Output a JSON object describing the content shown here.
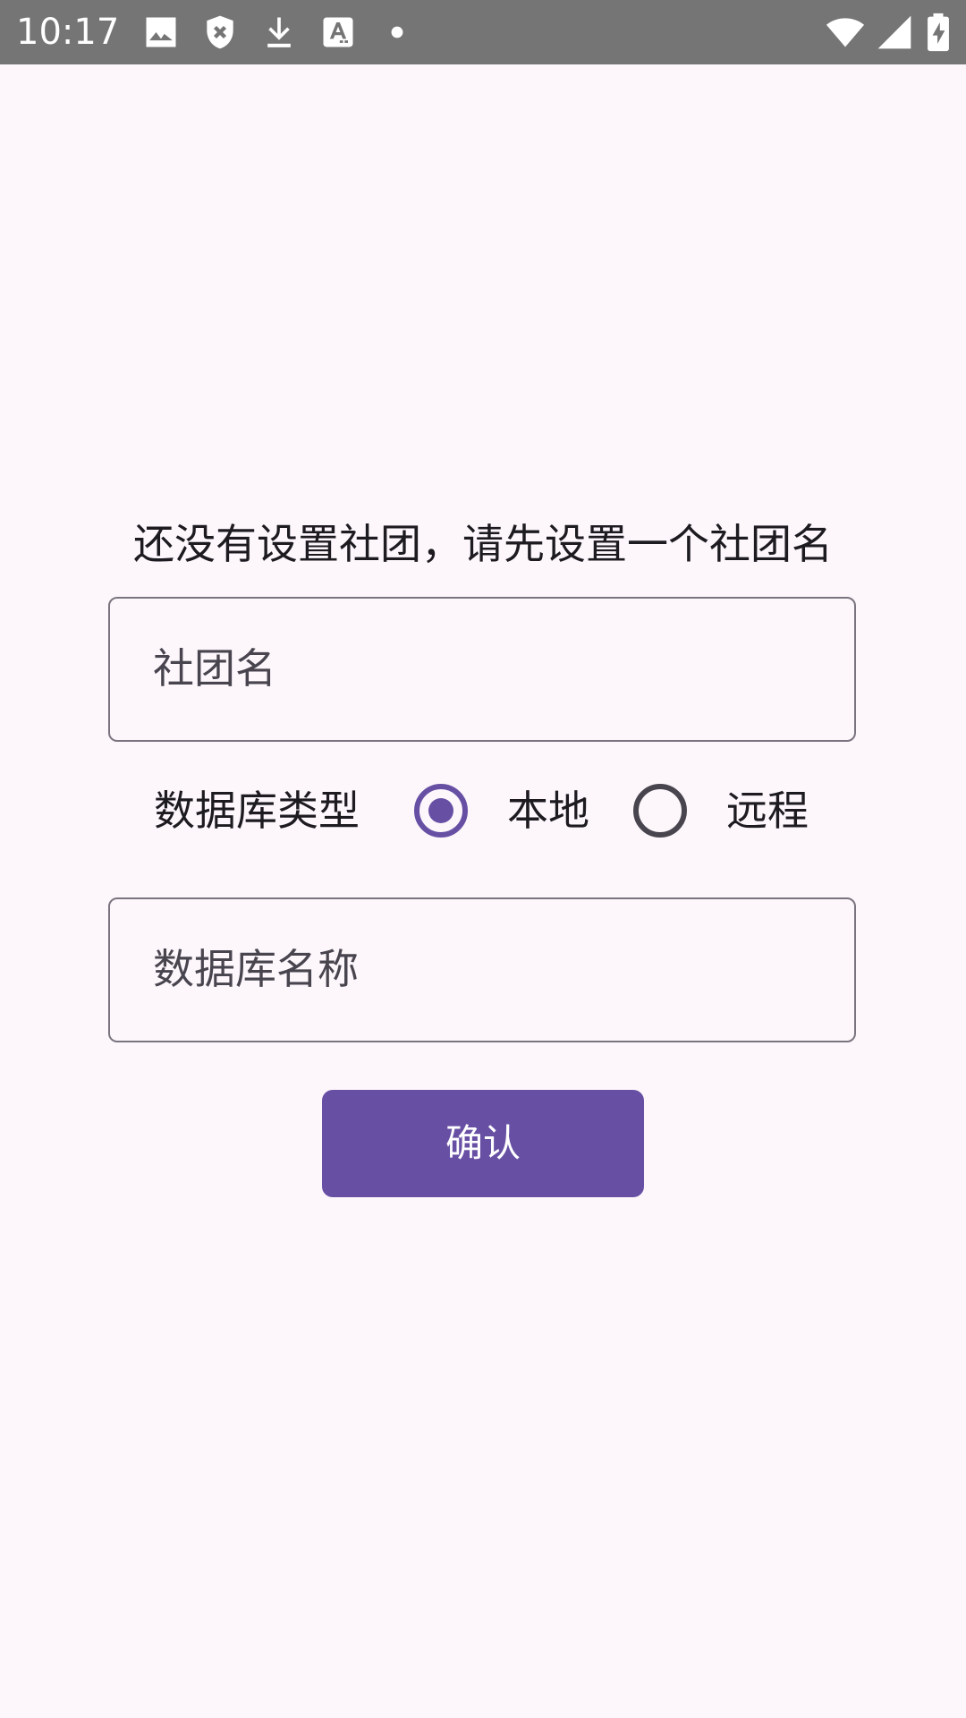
{
  "status_bar": {
    "time": "10:17",
    "left_icons": [
      "image-icon",
      "shield-x-icon",
      "download-icon",
      "font-download-icon",
      "dot-icon"
    ],
    "right_icons": [
      "wifi-icon",
      "cell-signal-icon",
      "battery-charging-icon"
    ]
  },
  "form": {
    "prompt": "还没有设置社团，请先设置一个社团名",
    "club_name_placeholder": "社团名",
    "db_type_label": "数据库类型",
    "db_type_options": [
      {
        "label": "本地",
        "selected": true
      },
      {
        "label": "远程",
        "selected": false
      }
    ],
    "db_name_placeholder": "数据库名称",
    "confirm_label": "确认"
  },
  "colors": {
    "background": "#FDF7FC",
    "status_bar": "#757575",
    "accent": "#6750A4",
    "outline": "#79747E",
    "text_primary": "#1D1B20",
    "text_secondary": "#49454F"
  }
}
